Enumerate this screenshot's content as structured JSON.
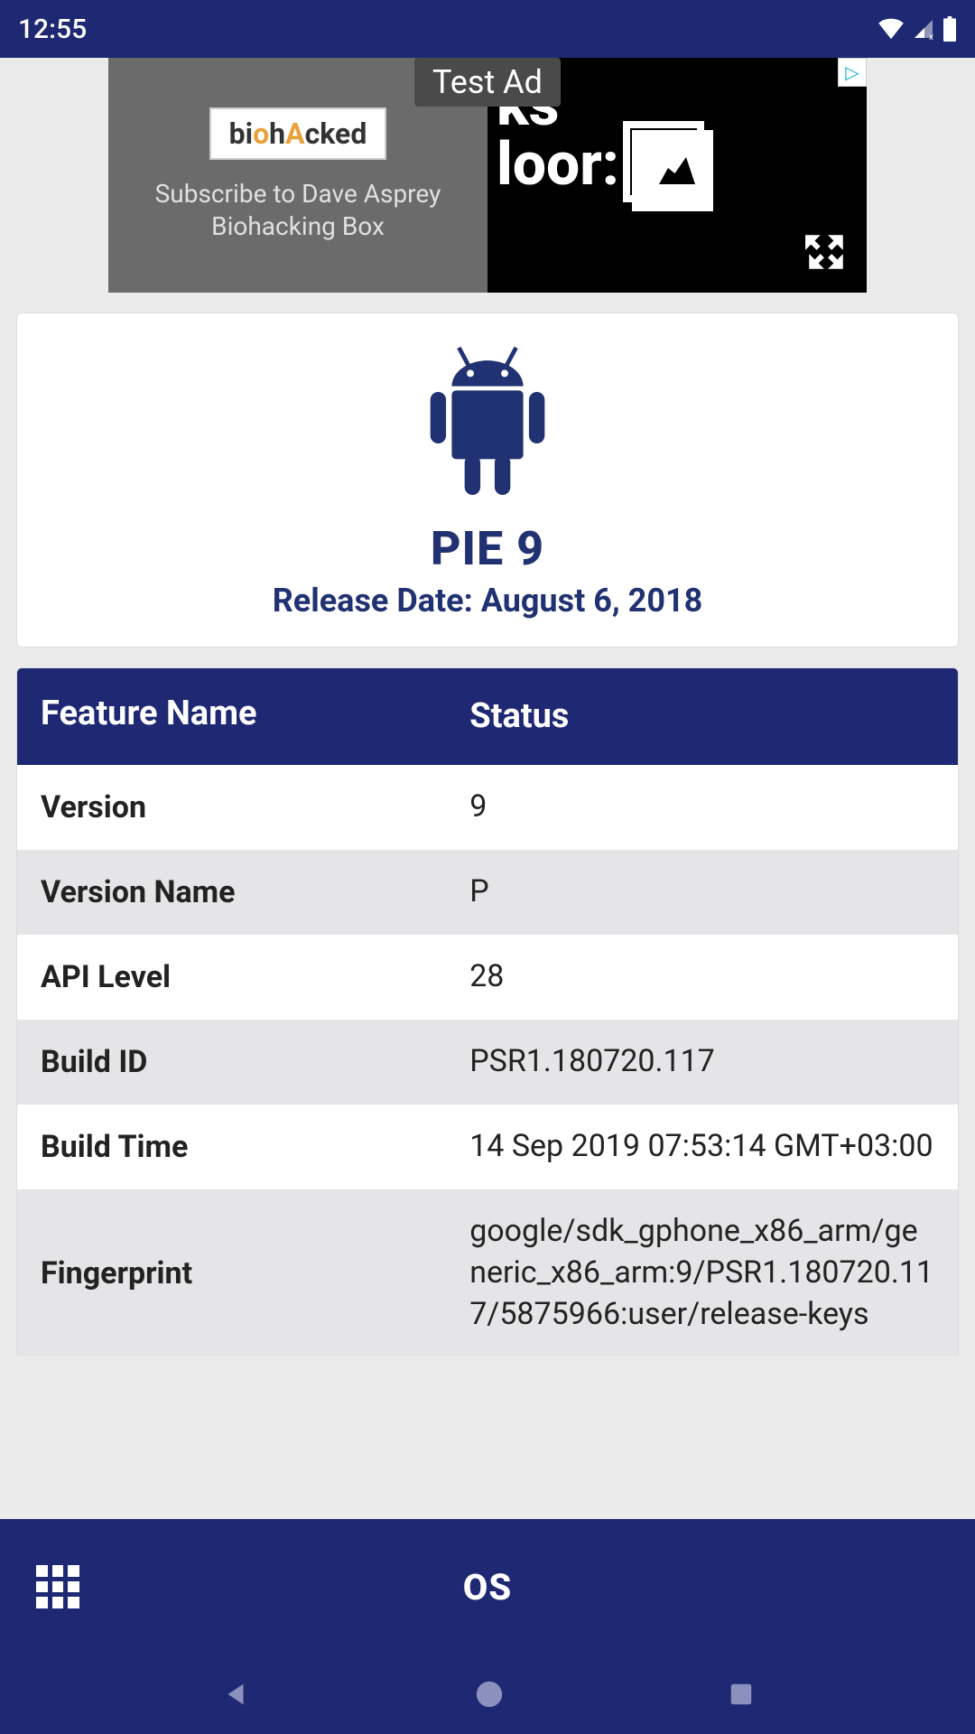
{
  "status_bar": {
    "time": "12:55"
  },
  "ad": {
    "test_label": "Test Ad",
    "brand_pre": "bi",
    "brand_mid": "o",
    "brand_post": "h",
    "brand_accent": "A",
    "brand_end": "cked",
    "subtitle": "Subscribe to Dave Asprey Biohacking Box",
    "right_text_1": "ks",
    "right_text_2": "loor"
  },
  "os_card": {
    "title": "PIE 9",
    "release_label": "Release Date: August 6, 2018"
  },
  "table": {
    "header_feature": "Feature Name",
    "header_status": "Status",
    "rows": [
      {
        "name": "Version",
        "status": "9"
      },
      {
        "name": "Version Name",
        "status": "P"
      },
      {
        "name": "API Level",
        "status": "28"
      },
      {
        "name": "Build ID",
        "status": "PSR1.180720.117"
      },
      {
        "name": "Build Time",
        "status": "14 Sep 2019 07:53:14 GMT+03:00"
      },
      {
        "name": "Fingerprint",
        "status": "google/sdk_gphone_x86_arm/generic_x86_arm:9/PSR1.180720.117/5875966:user/release-keys"
      }
    ]
  },
  "bottom_bar": {
    "title": "OS"
  }
}
